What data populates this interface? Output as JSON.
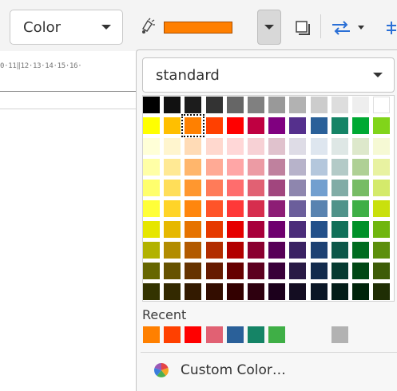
{
  "toolbar": {
    "color_select_label": "Color",
    "current_color": "#ff7f00"
  },
  "ruler": {
    "text": "0·11‖12·13·14·15·16·"
  },
  "popup": {
    "palette_name": "standard",
    "palette_colors": [
      [
        "#000000",
        "#111111",
        "#1c1c1c",
        "#333333",
        "#666666",
        "#808080",
        "#999999",
        "#b2b2b2",
        "#cccccc",
        "#dddddd",
        "#eeeeee",
        "#ffffff"
      ],
      [
        "#ffff00",
        "#ffbf00",
        "#ff8000",
        "#ff4000",
        "#ff0000",
        "#bf0041",
        "#800080",
        "#55308d",
        "#2a6099",
        "#158466",
        "#00a933",
        "#81d41a"
      ],
      [
        "#ffffd7",
        "#fff5ce",
        "#ffdbb6",
        "#ffd8ce",
        "#ffd7d7",
        "#f7d1d5",
        "#e0c2cd",
        "#dedce6",
        "#dee6ef",
        "#dee7e5",
        "#dde8cb",
        "#f6f9d4"
      ],
      [
        "#ffffa6",
        "#ffe994",
        "#ffb66c",
        "#ffaa95",
        "#ffa6a6",
        "#ec9ba4",
        "#bf819e",
        "#b7b3ca",
        "#b4c7dc",
        "#b3cac7",
        "#afd095",
        "#e8f2a1"
      ],
      [
        "#ffff6d",
        "#ffde59",
        "#ff972f",
        "#ff7b59",
        "#ff6d6d",
        "#e16173",
        "#a1467e",
        "#8e86ae",
        "#729fcf",
        "#81aca6",
        "#77bc65",
        "#d4ea6b"
      ],
      [
        "#ffff38",
        "#ffd428",
        "#ff860d",
        "#ff5429",
        "#ff3838",
        "#d62e4e",
        "#8d1d75",
        "#6b5e9b",
        "#5983b0",
        "#50938a",
        "#3faf46",
        "#c9e00d"
      ],
      [
        "#e6e600",
        "#e6b800",
        "#e67300",
        "#e63a00",
        "#e60000",
        "#a8003b",
        "#6e006e",
        "#4b2d7a",
        "#23508a",
        "#117059",
        "#009129",
        "#70b60f"
      ],
      [
        "#b2b200",
        "#b28c00",
        "#b25a00",
        "#b22d00",
        "#b20000",
        "#8a0030",
        "#570057",
        "#3a2263",
        "#1d4173",
        "#0d5749",
        "#006c1f",
        "#5c8f0c"
      ],
      [
        "#666600",
        "#665200",
        "#663300",
        "#661a00",
        "#660000",
        "#5c001f",
        "#390039",
        "#291a45",
        "#132b4c",
        "#063a31",
        "#004714",
        "#3d5c08"
      ],
      [
        "#333300",
        "#332900",
        "#331a00",
        "#330d00",
        "#330000",
        "#2e000f",
        "#1c001c",
        "#140d22",
        "#0a1626",
        "#031d18",
        "#00240a",
        "#1f2e04"
      ]
    ],
    "selected_color": "#ff8000",
    "recent_label": "Recent",
    "recent_colors": [
      "#ff8000",
      "#ff4000",
      "#ff0000",
      "#e16173",
      "#2a6099",
      "#158466",
      "#3faf46",
      null,
      null,
      "#b2b2b2"
    ],
    "custom_color_label": "Custom Color…"
  }
}
